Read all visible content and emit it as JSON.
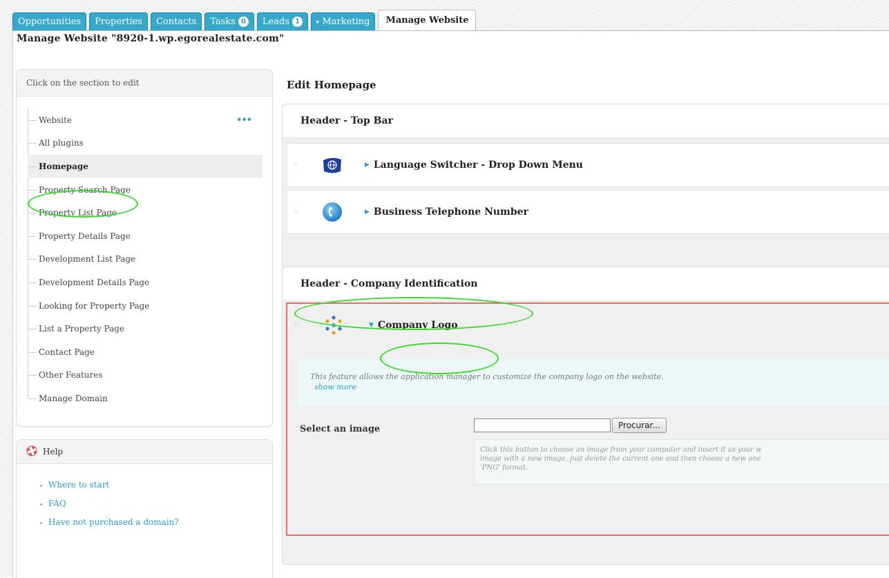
{
  "tabs": [
    {
      "label": "Opportunities"
    },
    {
      "label": "Properties"
    },
    {
      "label": "Contacts"
    },
    {
      "label": "Tasks",
      "badge": "0"
    },
    {
      "label": "Leads",
      "badge": "1"
    },
    {
      "label": "Marketing"
    },
    {
      "label": "Manage Website"
    }
  ],
  "page_title": "Manage Website \"8920-1.wp.egorealestate.com\"",
  "sidebar": {
    "header": "Click on the section to edit",
    "items": [
      {
        "label": "Website"
      },
      {
        "label": "All plugins"
      },
      {
        "label": "Homepage"
      },
      {
        "label": "Property Search Page"
      },
      {
        "label": "Property List Page"
      },
      {
        "label": "Property Details Page"
      },
      {
        "label": "Development List Page"
      },
      {
        "label": "Development Details Page"
      },
      {
        "label": "Looking for Property Page"
      },
      {
        "label": "List a Property Page"
      },
      {
        "label": "Contact Page"
      },
      {
        "label": "Other Features"
      },
      {
        "label": "Manage Domain"
      }
    ],
    "more_dots": "•••"
  },
  "help": {
    "header": "Help",
    "links": [
      {
        "label": "Where to start"
      },
      {
        "label": "FAQ"
      },
      {
        "label": "Have not purchased a domain?"
      }
    ]
  },
  "main": {
    "title": "Edit Homepage",
    "section_top_bar": {
      "title": "Header - Top Bar",
      "features": [
        {
          "label": "Language Switcher - Drop Down Menu",
          "icon": "globe-flag-icon"
        },
        {
          "label": "Business Telephone Number",
          "icon": "telephone-icon"
        }
      ]
    },
    "section_company": {
      "title": "Header - Company Identification",
      "feature": {
        "label": "Company Logo",
        "icon": "company-logo-icon",
        "description": "This feature allows the application manager to customize the company logo on the website.",
        "show_more": "show more",
        "select_label": "Select an image",
        "file_value": "",
        "browse_label": "Procurar...",
        "hint_line1": "Click this button to choose an image from your computer and insert it as your w",
        "hint_line2": "image with a new image, just delete the current one and then choose a new one",
        "hint_line3": "'PNG' format."
      }
    }
  },
  "colors": {
    "tab_blue": "#35a8cc",
    "link_blue": "#2a9bd5",
    "highlight_green": "#33dd22",
    "selected_border_red": "#e07070"
  }
}
